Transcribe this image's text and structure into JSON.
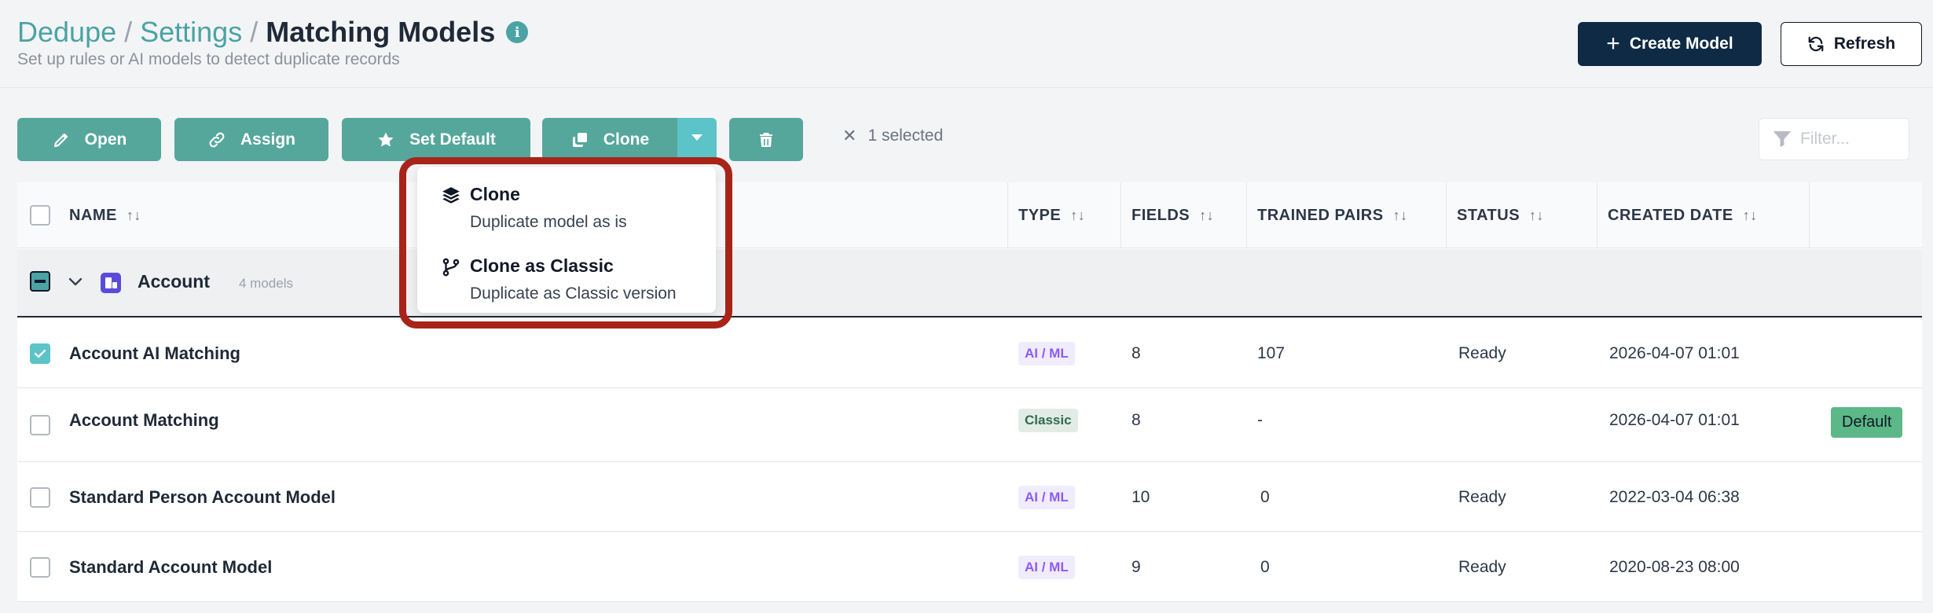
{
  "breadcrumb": {
    "root": "Dedupe",
    "sep1": "/",
    "middle": "Settings",
    "sep2": "/",
    "current": "Matching Models",
    "info": "i"
  },
  "subtitle": "Set up rules or AI models to detect duplicate records",
  "header_actions": {
    "create_label": "Create Model",
    "refresh_label": "Refresh"
  },
  "toolbar": {
    "open_label": "Open",
    "assign_label": "Assign",
    "set_default_label": "Set Default",
    "clone_label": "Clone",
    "selected_text": "1 selected",
    "filter_placeholder": "Filter..."
  },
  "clone_menu": [
    {
      "title": "Clone",
      "description": "Duplicate model as is",
      "icon": "layers-icon"
    },
    {
      "title": "Clone as Classic",
      "description": "Duplicate as Classic version",
      "icon": "branch-icon"
    }
  ],
  "table": {
    "columns": {
      "name": "NAME",
      "type": "TYPE",
      "fields": "FIELDS",
      "trained_pairs": "TRAINED PAIRS",
      "status": "STATUS",
      "created_date": "CREATED DATE"
    },
    "group": {
      "label": "Account",
      "count": "4 models"
    },
    "rows": [
      {
        "name": "Account AI Matching",
        "type": "AI / ML",
        "fields": "8",
        "trained_pairs": "107",
        "status": "Ready",
        "created": "2026-04-07 01:01",
        "default": "",
        "checked": true
      },
      {
        "name": "Account Matching",
        "type": "Classic",
        "fields": "8",
        "trained_pairs": "-",
        "status": "",
        "created": "2026-04-07 01:01",
        "default": "Default",
        "checked": false
      },
      {
        "name": "Standard Person Account Model",
        "type": "AI / ML",
        "fields": "10",
        "trained_pairs": "0",
        "status": "Ready",
        "created": "2022-03-04 06:38",
        "default": "",
        "checked": false
      },
      {
        "name": "Standard Account Model",
        "type": "AI / ML",
        "fields": "9",
        "trained_pairs": "0",
        "status": "Ready",
        "created": "2020-08-23 08:00",
        "default": "",
        "checked": false
      }
    ]
  },
  "colors": {
    "accent": "#55a79c",
    "accent_light": "#5cc3c8",
    "primary_dark": "#0f2a44",
    "highlight": "#a82418"
  }
}
